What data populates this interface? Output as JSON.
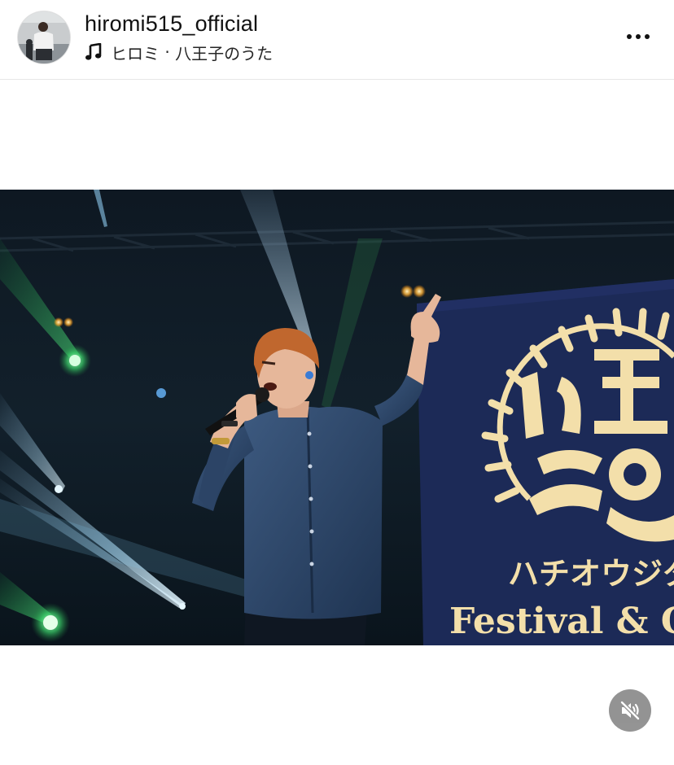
{
  "post": {
    "username": "hiromi515_official",
    "audio": {
      "artist": "ヒロミ",
      "separator": " · ",
      "track": "八王子のうた",
      "icon": "music-note-icon"
    },
    "more_icon": "more-horizontal-icon"
  },
  "media": {
    "stage_banner": {
      "title": "八王子魂",
      "kana": "ハチオウジタ",
      "english": "Festival & C"
    },
    "mute_icon": "speaker-muted-icon"
  }
}
